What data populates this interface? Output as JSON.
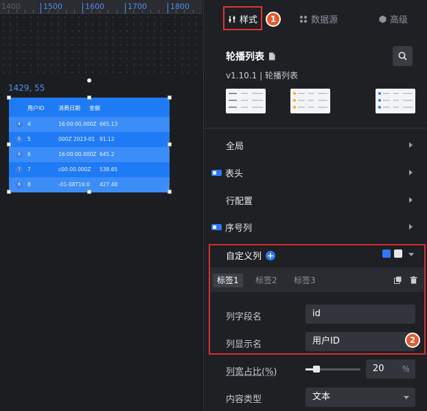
{
  "ruler": {
    "labels": [
      "1400",
      "1500",
      "1600",
      "1700",
      "1800"
    ]
  },
  "canvas": {
    "coordinate_readout": "1429, 55"
  },
  "widget_preview": {
    "headers": [
      "用户ID",
      "消费日期",
      "金额"
    ],
    "rows": [
      {
        "index": "4",
        "id": "4",
        "date": "16:00:00.000Z",
        "amount": "665.13"
      },
      {
        "index": "5",
        "id": "5",
        "date": "000Z 2023-01",
        "amount": "91.12"
      },
      {
        "index": "6",
        "id": "6",
        "date": "16:00:00.000Z",
        "amount": "645.2"
      },
      {
        "index": "7",
        "id": "7",
        "date": "c00:00.000Z",
        "amount": "538.65"
      },
      {
        "index": "8",
        "id": "8",
        "date": "-01-08T16:0",
        "amount": "427.48"
      }
    ],
    "colors": {
      "background": "#1f7af5",
      "alt_row": "#3c8df7"
    }
  },
  "panel_tabs": [
    {
      "label": "样式",
      "icon": "sliders-icon",
      "active": true
    },
    {
      "label": "数据源",
      "icon": "dots-grid-icon",
      "active": false
    },
    {
      "label": "高级",
      "icon": "hexagon-icon",
      "active": false
    }
  ],
  "step_badges": [
    "1",
    "2"
  ],
  "component": {
    "title": "轮播列表",
    "version_line": "v1.10.1 | 轮播列表"
  },
  "sections": [
    {
      "label": "全局",
      "toggle": false
    },
    {
      "label": "表头",
      "toggle": true
    },
    {
      "label": "行配置",
      "toggle": false
    },
    {
      "label": "序号列",
      "toggle": true
    }
  ],
  "custom_column": {
    "title": "自定义列",
    "subtabs": [
      "标签1",
      "标签2",
      "标签3"
    ],
    "active_subtab": "标签1",
    "field_name_label": "列字段名",
    "field_name_value": "id",
    "display_name_label": "列显示名",
    "display_name_value": "用户ID"
  },
  "width_ratio": {
    "label": "列宽占比(%)",
    "value": "20",
    "unit": "%",
    "slider_fraction": 0.2
  },
  "content_type": {
    "label": "内容类型",
    "value": "文本"
  },
  "accent_colors": {
    "primary": "#2f79f4",
    "highlight": "#e23535",
    "badge": "#e8582d"
  }
}
